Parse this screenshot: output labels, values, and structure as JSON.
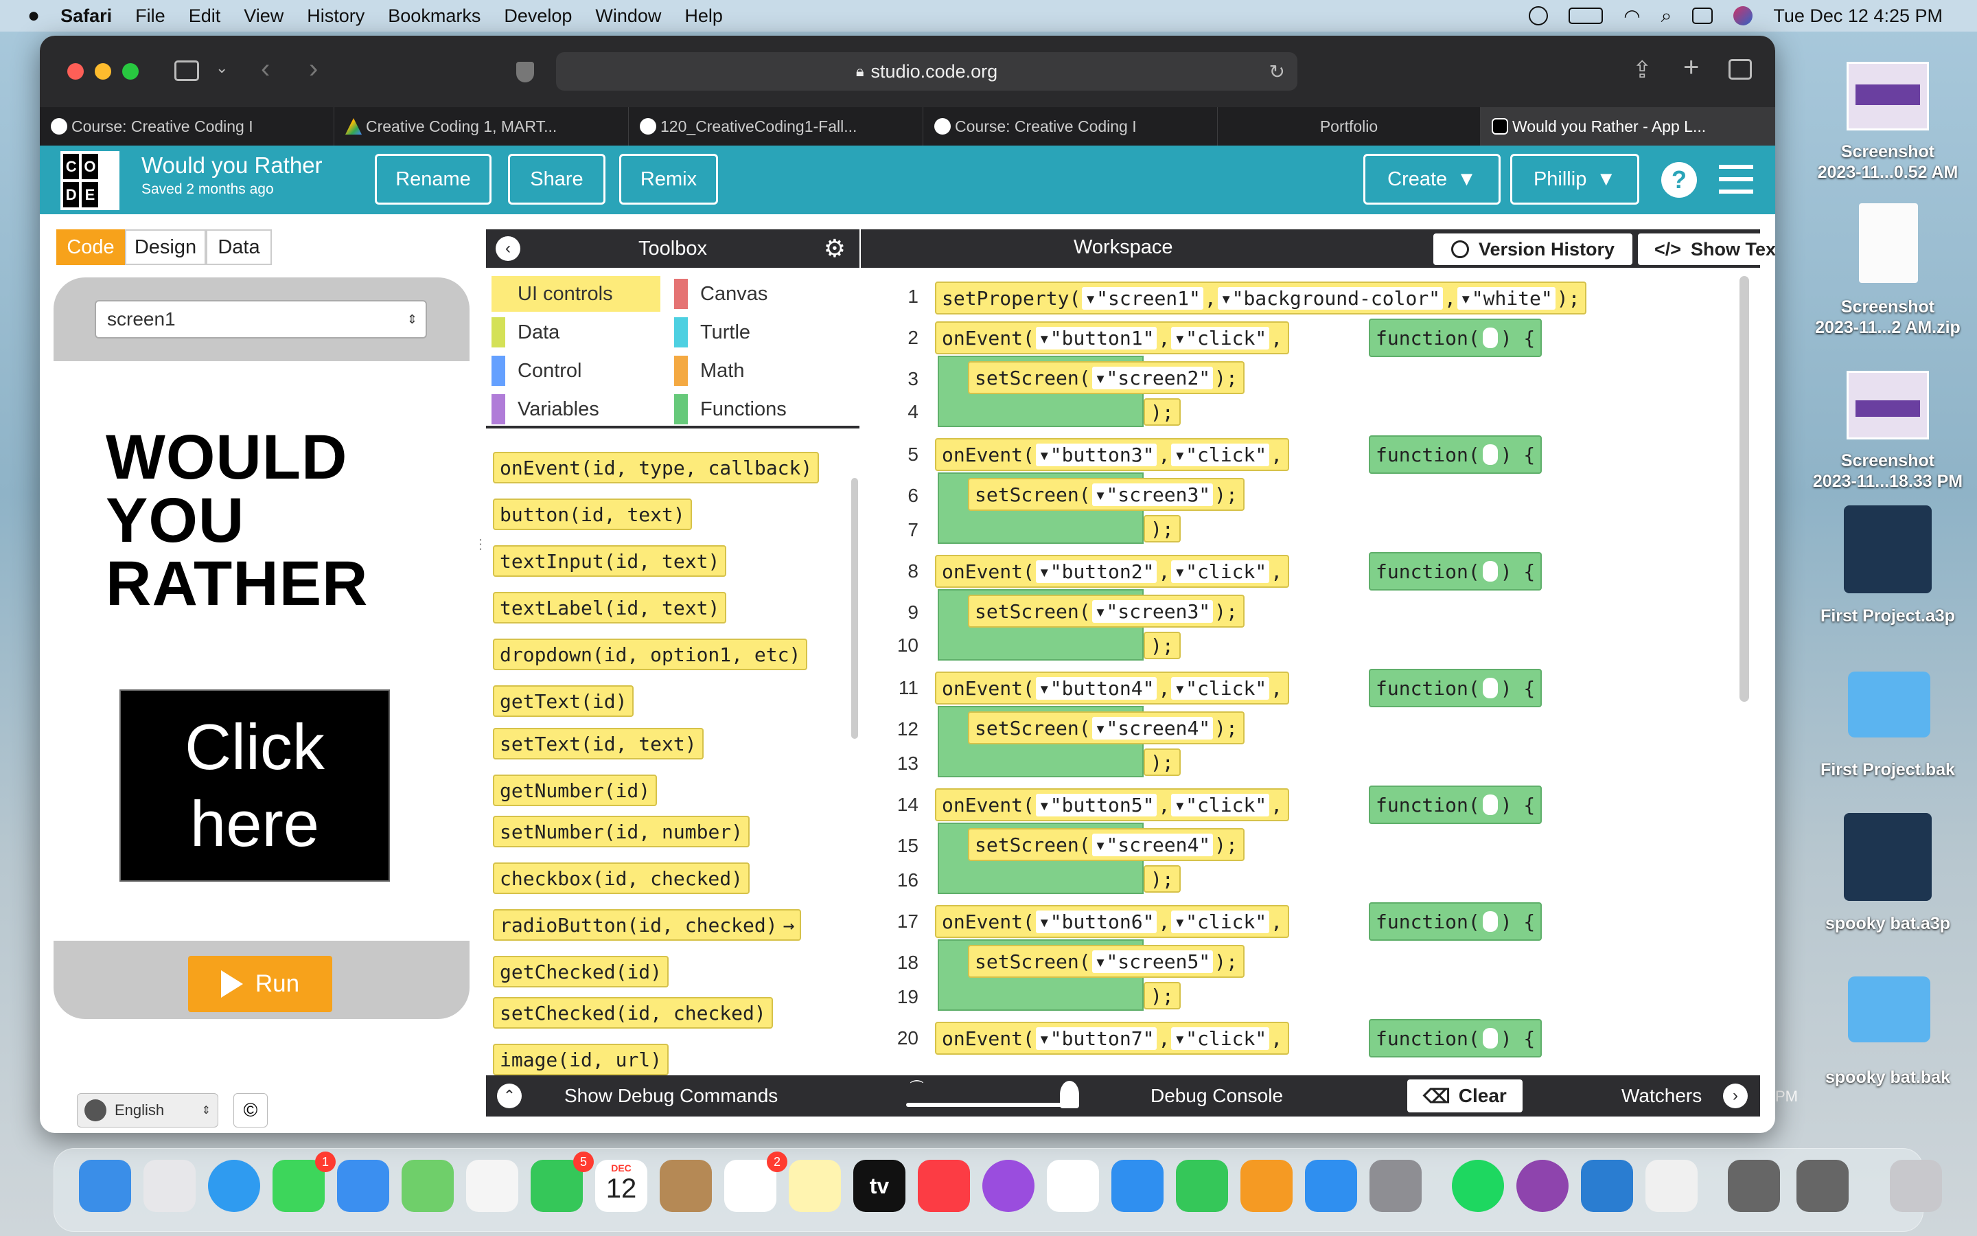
{
  "menubar": {
    "app": "Safari",
    "items": [
      "File",
      "Edit",
      "View",
      "History",
      "Bookmarks",
      "Develop",
      "Window",
      "Help"
    ],
    "clock": "Tue Dec 12  4:25 PM"
  },
  "browser": {
    "url": "studio.code.org",
    "tabs": [
      {
        "label": "Course: Creative Coding I"
      },
      {
        "label": "Creative Coding 1, MART..."
      },
      {
        "label": "120_CreativeCoding1-Fall..."
      },
      {
        "label": "Course: Creative Coding I"
      },
      {
        "label": "Portfolio"
      },
      {
        "label": "Would you Rather - App L..."
      }
    ]
  },
  "app": {
    "logo_letters": [
      "C",
      "O",
      "",
      "D",
      "E",
      ""
    ],
    "title": "Would you Rather",
    "saved": "Saved 2 months ago",
    "buttons": {
      "rename": "Rename",
      "share": "Share",
      "remix": "Remix",
      "create": "Create",
      "user": "Phillip"
    },
    "help": "?",
    "modes": {
      "code": "Code",
      "design": "Design",
      "data": "Data"
    },
    "screen_select": "screen1",
    "app_heading": [
      "WOULD",
      "YOU",
      "RATHER"
    ],
    "click_button": [
      "Click",
      "here"
    ],
    "run": "Run",
    "language": "English",
    "copyright": "©"
  },
  "toolbox": {
    "title": "Toolbox",
    "categories": [
      {
        "label": "UI controls",
        "color": "#fdeb7a"
      },
      {
        "label": "Canvas",
        "color": "#e57373"
      },
      {
        "label": "Data",
        "color": "#d4e157"
      },
      {
        "label": "Turtle",
        "color": "#4dd0e1"
      },
      {
        "label": "Control",
        "color": "#64a0ff"
      },
      {
        "label": "Math",
        "color": "#f4a942"
      },
      {
        "label": "Variables",
        "color": "#b07cd8"
      },
      {
        "label": "Functions",
        "color": "#66c97a"
      }
    ],
    "blocks": [
      {
        "name": "onEvent",
        "params": "id, type, callback"
      },
      {
        "name": "button",
        "params": "id, text"
      },
      {
        "name": "textInput",
        "params": "id, text"
      },
      {
        "name": "textLabel",
        "params": "id, text"
      },
      {
        "name": "dropdown",
        "params": "id, option1, etc"
      },
      {
        "name": "getText",
        "params": "id"
      },
      {
        "name": "setText",
        "params": "id, text"
      },
      {
        "name": "getNumber",
        "params": "id"
      },
      {
        "name": "setNumber",
        "params": "id, number"
      },
      {
        "name": "checkbox",
        "params": "id, checked"
      },
      {
        "name": "radioButton",
        "params": "id, checked"
      },
      {
        "name": "getChecked",
        "params": "id"
      },
      {
        "name": "setChecked",
        "params": "id, checked"
      },
      {
        "name": "image",
        "params": "id, url"
      }
    ]
  },
  "workspace": {
    "title": "Workspace",
    "version_history": "Version History",
    "show_text": "Show Text",
    "line_numbers": [
      "1",
      "2",
      "3",
      "4",
      "5",
      "6",
      "7",
      "8",
      "9",
      "10",
      "11",
      "12",
      "13",
      "14",
      "15",
      "16",
      "17",
      "18",
      "19",
      "20"
    ],
    "setProperty": {
      "fn": "setProperty",
      "args": [
        "\"screen1\"",
        "\"background-color\"",
        "\"white\""
      ]
    },
    "events": [
      {
        "button": "\"button1\"",
        "screen": "\"screen2\""
      },
      {
        "button": "\"button3\"",
        "screen": "\"screen3\""
      },
      {
        "button": "\"button2\"",
        "screen": "\"screen3\""
      },
      {
        "button": "\"button4\"",
        "screen": "\"screen4\""
      },
      {
        "button": "\"button5\"",
        "screen": "\"screen4\""
      },
      {
        "button": "\"button6\"",
        "screen": "\"screen5\""
      },
      {
        "button": "\"button7\"",
        "screen": ""
      }
    ],
    "event_word": "onEvent",
    "click_word": "\"click\"",
    "function_word": "function",
    "setscreen_word": "setScreen"
  },
  "debug": {
    "show_commands": "Show Debug Commands",
    "console": "Debug Console",
    "clear": "Clear",
    "watchers": "Watchers",
    "fragment": "PM"
  },
  "desktop": [
    {
      "label": "Screenshot\n2023-11...0.52 AM"
    },
    {
      "label": "Screenshot\n2023-11...2 AM.zip"
    },
    {
      "label": "Screenshot\n2023-11...18.33 PM"
    },
    {
      "label": "First Project.a3p"
    },
    {
      "label": "First Project.bak"
    },
    {
      "label": "spooky bat.a3p"
    },
    {
      "label": "spooky bat.bak"
    }
  ],
  "dock": {
    "badges": {
      "messages": "1",
      "facetime": "5",
      "reminders": "2"
    },
    "calendar_month": "DEC",
    "calendar_day": "12",
    "tv_label": "tv"
  }
}
